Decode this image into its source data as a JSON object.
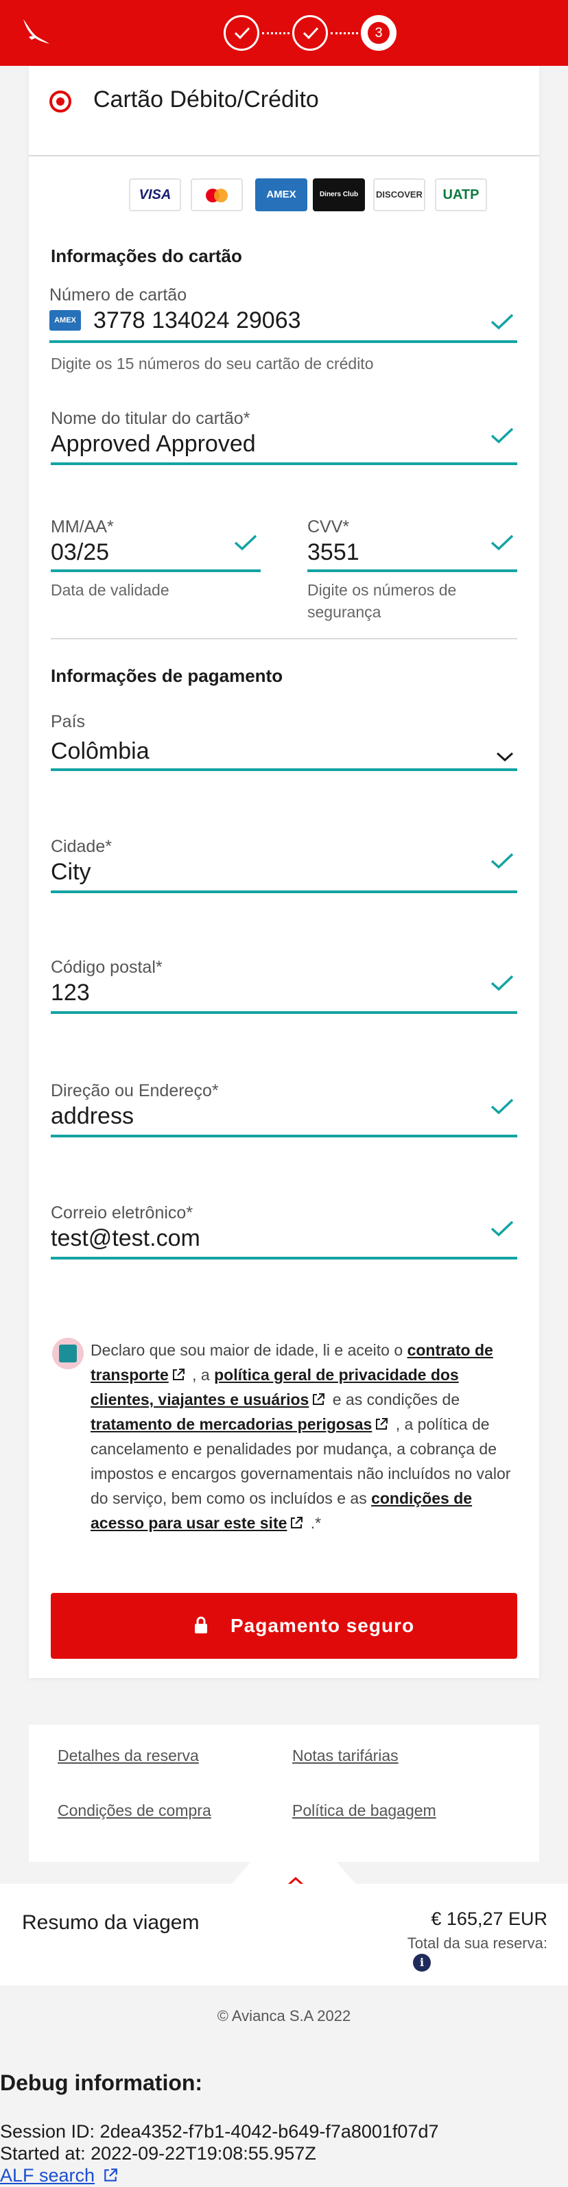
{
  "header": {
    "steps": [
      {
        "state": "done"
      },
      {
        "state": "done"
      },
      {
        "state": "current",
        "number": "3"
      }
    ],
    "brand_color": "#e10a0a"
  },
  "payment_method": {
    "title": "Cartão Débito/Crédito",
    "brands": [
      "VISA",
      "mastercard",
      "AMEX",
      "Diners Club",
      "DISCOVER",
      "UATP"
    ]
  },
  "card_info": {
    "section_title": "Informações do cartão",
    "card_number": {
      "label": "Número de cartão",
      "value": "3778 134024 29063",
      "help": "Digite os 15 números do seu cartão de crédito",
      "card_badge": "AMEX"
    },
    "holder_name": {
      "label": "Nome do titular do cartão*",
      "value": "Approved Approved"
    },
    "expiry": {
      "label": "MM/AA*",
      "value": "03/25",
      "help": "Data de validade"
    },
    "cvv": {
      "label": "CVV*",
      "value": "3551",
      "help": "Digite os números de segurança"
    }
  },
  "payment_info": {
    "section_title": "Informações de pagamento",
    "country": {
      "label": "País",
      "value": "Colômbia"
    },
    "city": {
      "label": "Cidade*",
      "value": "City"
    },
    "postal_code": {
      "label": "Código postal*",
      "value": "123"
    },
    "address": {
      "label": "Direção ou Endereço*",
      "value": "address"
    },
    "email": {
      "label": "Correio eletrônico*",
      "value": "test@test.com"
    }
  },
  "consent": {
    "t1": "Declaro que sou maior de idade, li e aceito o ",
    "link1": "contrato de transporte",
    "t2": " , a ",
    "link2": "política geral de privacidade dos clientes, viajantes e usuários",
    "t3": " e as condições de ",
    "link3": "tratamento de mercadorias perigosas",
    "t4": " , a política de cancelamento e penalidades por mudança, a cobrança de impostos e encargos governamentais não incluídos no valor do serviço, bem como os incluídos e as ",
    "link4": "condições de acesso para usar este site",
    "t5": " .*"
  },
  "pay_button": {
    "label": "Pagamento seguro"
  },
  "footer_links": [
    "Detalhes da reserva",
    "Notas tarifárias",
    "Condições de compra",
    "Política de bagagem"
  ],
  "summary": {
    "title": "Resumo da viagem",
    "price": "€ 165,27 EUR",
    "total_label": "Total da sua reserva:"
  },
  "copyright": "© Avianca S.A 2022",
  "debug": {
    "title": "Debug information:",
    "session": "Session ID: 2dea4352-f7b1-4042-b649-f7a8001f07d7",
    "started": "Started at: 2022-09-22T19:08:55.957Z",
    "link": "ALF search"
  },
  "colors": {
    "accent": "#14a3a3",
    "primary": "#e10a0a",
    "checkbox": "#1a8f98"
  }
}
